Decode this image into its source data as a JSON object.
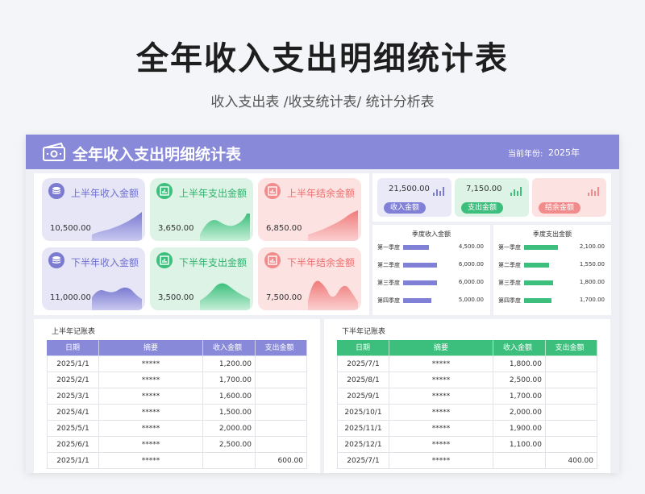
{
  "page": {
    "title": "全年收入支出明细统计表",
    "subtitle": "收入支出表 /收支统计表/ 统计分析表"
  },
  "sheet": {
    "title": "全年收入支出明细统计表",
    "year_label": "当前年份:",
    "year_value": "2025年"
  },
  "kpis": [
    {
      "label": "上半年收入金额",
      "value": "10,500.00",
      "color": "#7b7bd2"
    },
    {
      "label": "上半年支出金额",
      "value": "3,650.00",
      "color": "#3cbf7c"
    },
    {
      "label": "上半年结余金额",
      "value": "6,850.00",
      "color": "#f28c8c"
    },
    {
      "label": "下半年收入金额",
      "value": "11,000.00",
      "color": "#7b7bd2"
    },
    {
      "label": "下半年支出金额",
      "value": "3,500.00",
      "color": "#3cbf7c"
    },
    {
      "label": "下半年结余金额",
      "value": "7,500.00",
      "color": "#f28c8c"
    }
  ],
  "summary": [
    {
      "value": "21,500.00",
      "label": "收入金额"
    },
    {
      "value": "7,150.00",
      "label": "支出金额"
    },
    {
      "value": "",
      "label": "结余金额"
    }
  ],
  "quarter_income": {
    "title": "季度收入金额",
    "color": "#8080d6",
    "rows": [
      {
        "label": "第一季度",
        "value": "4,500.00",
        "amount": 4500
      },
      {
        "label": "第二季度",
        "value": "6,000.00",
        "amount": 6000
      },
      {
        "label": "第三季度",
        "value": "6,000.00",
        "amount": 6000
      },
      {
        "label": "第四季度",
        "value": "5,000.00",
        "amount": 5000
      }
    ]
  },
  "quarter_expense": {
    "title": "季度支出金额",
    "color": "#3cbf7c",
    "rows": [
      {
        "label": "第一季度",
        "value": "2,100.00",
        "amount": 2100
      },
      {
        "label": "第二季度",
        "value": "1,550.00",
        "amount": 1550
      },
      {
        "label": "第三季度",
        "value": "1,800.00",
        "amount": 1800
      },
      {
        "label": "第四季度",
        "value": "1,700.00",
        "amount": 1700
      }
    ]
  },
  "ledger_h1": {
    "caption": "上半年记账表",
    "header_color": "#8989d9",
    "columns": [
      "日期",
      "摘要",
      "收入金额",
      "支出金额"
    ],
    "rows": [
      [
        "2025/1/1",
        "*****",
        "1,200.00",
        ""
      ],
      [
        "2025/2/1",
        "*****",
        "1,700.00",
        ""
      ],
      [
        "2025/3/1",
        "*****",
        "1,600.00",
        ""
      ],
      [
        "2025/4/1",
        "*****",
        "1,500.00",
        ""
      ],
      [
        "2025/5/1",
        "*****",
        "2,000.00",
        ""
      ],
      [
        "2025/6/1",
        "*****",
        "2,500.00",
        ""
      ],
      [
        "2025/1/1",
        "*****",
        "",
        "600.00"
      ]
    ]
  },
  "ledger_h2": {
    "caption": "下半年记账表",
    "header_color": "#3cbf7c",
    "columns": [
      "日期",
      "摘要",
      "收入金额",
      "支出金额"
    ],
    "rows": [
      [
        "2025/7/1",
        "*****",
        "1,800.00",
        ""
      ],
      [
        "2025/8/1",
        "*****",
        "2,500.00",
        ""
      ],
      [
        "2025/9/1",
        "*****",
        "1,700.00",
        ""
      ],
      [
        "2025/10/1",
        "*****",
        "2,000.00",
        ""
      ],
      [
        "2025/11/1",
        "*****",
        "1,900.00",
        ""
      ],
      [
        "2025/12/1",
        "*****",
        "1,100.00",
        ""
      ],
      [
        "2025/7/1",
        "*****",
        "",
        "400.00"
      ]
    ]
  }
}
